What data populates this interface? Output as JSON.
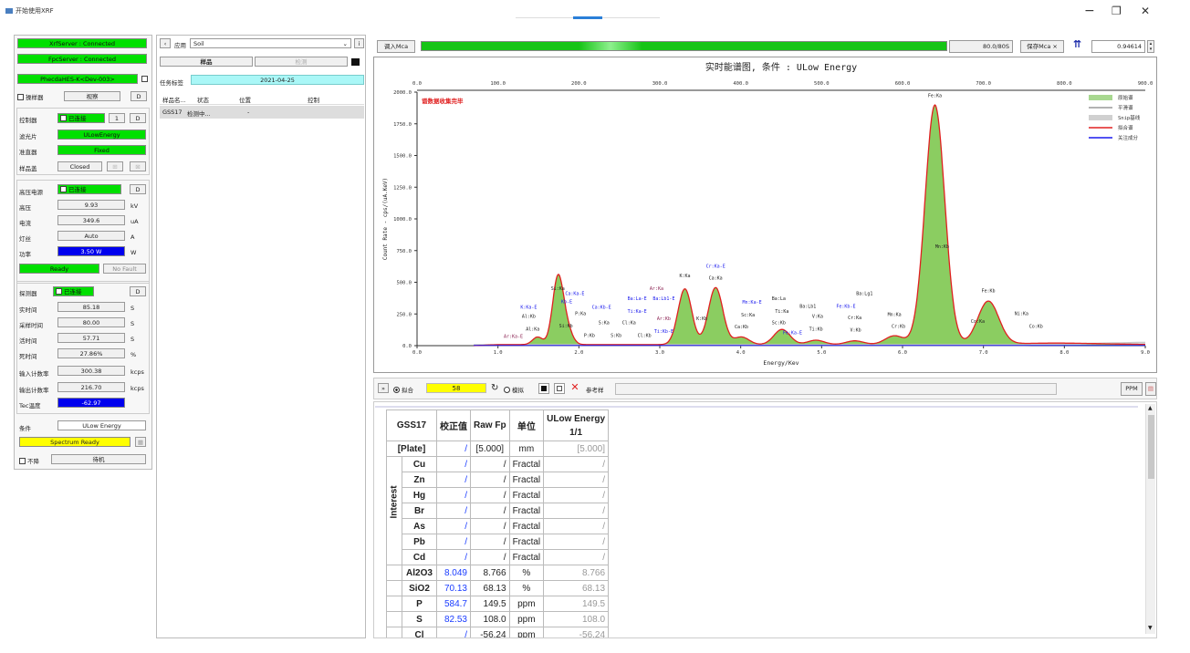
{
  "window": {
    "title": "开始使用XRF",
    "minimize": "−",
    "restore": "❐",
    "close": "✕"
  },
  "left": {
    "xrf_server": "XrfServer : Connected",
    "fpc_server": "FpcServer : Connected",
    "device": "PhecdaHES-K<Dev-003>",
    "sampler_label": "操样器",
    "sampler_btn": "视察",
    "d": "D",
    "controller": {
      "label": "控制器",
      "status": "已连接",
      "one": "1",
      "d": "D"
    },
    "filter": {
      "label": "滤光片",
      "value": "ULowEnergy"
    },
    "collimator": {
      "label": "准直器",
      "value": "Fixed"
    },
    "lid": {
      "label": "样品盖",
      "value": "Closed"
    },
    "hv": {
      "label": "高压电源",
      "status": "已连接",
      "d": "D",
      "rows": [
        {
          "label": "高压",
          "value": "9.93",
          "unit": "kV"
        },
        {
          "label": "电流",
          "value": "349.6",
          "unit": "uA"
        },
        {
          "label": "灯丝",
          "value": "Auto",
          "unit": "A"
        },
        {
          "label": "功率",
          "value": "3.50 W",
          "unit": "W"
        }
      ],
      "ready": "Ready",
      "fault": "No Fault"
    },
    "detector": {
      "label": "探测器",
      "status": "已连接",
      "d": "D",
      "rows": [
        {
          "label": "实时间",
          "value": "85.18",
          "unit": "S"
        },
        {
          "label": "采样时间",
          "value": "80.00",
          "unit": "S"
        },
        {
          "label": "活时间",
          "value": "57.71",
          "unit": "S"
        },
        {
          "label": "死时间",
          "value": "27.86%",
          "unit": "%"
        },
        {
          "label": "输入计数率",
          "value": "300.38",
          "unit": "kcps"
        },
        {
          "label": "输出计数率",
          "value": "216.70",
          "unit": "kcps"
        },
        {
          "label": "Tec温度",
          "value": "-62.97",
          "unit": ""
        }
      ]
    },
    "condition": {
      "label": "条件",
      "value": "ULow Energy"
    },
    "spectrum": "Spectrum Ready",
    "standby_chk": "不降",
    "standby": "待机"
  },
  "mid": {
    "app_label": "应用",
    "app_value": "Soil",
    "tab_sample": "样品",
    "tab_detect": "检测",
    "task_label": "任务标签",
    "task_value": "2021-04-25",
    "cols": [
      "样品名...",
      "状态",
      "位置",
      "控制"
    ],
    "row": [
      "GSS17",
      "检测中...",
      "-",
      ""
    ]
  },
  "toolbar": {
    "import": "调入Mca",
    "count": "80.0/80S",
    "save": "保存Mca ×",
    "value": "0.94614"
  },
  "chart_data": {
    "type": "line",
    "title": "实时能谱图, 条件 : ULow Energy",
    "annotation": "谱数据收集完毕",
    "xlabel": "Energy/Kev",
    "ylabel": "Count Rate - cps/(uA.KeV)",
    "xlim": [
      0,
      9
    ],
    "ylim": [
      0,
      2000
    ],
    "top_axis": [
      "0.0",
      "100.0",
      "200.0",
      "300.0",
      "400.0",
      "500.0",
      "600.0",
      "700.0",
      "800.0",
      "900.0"
    ],
    "x_ticks": [
      "0.0",
      "1.0",
      "2.0",
      "3.0",
      "4.0",
      "5.0",
      "6.0",
      "7.0",
      "8.0",
      "9.0"
    ],
    "y_ticks": [
      "0.0",
      "250.0",
      "500.0",
      "750.0",
      "1000.0",
      "1250.0",
      "1500.0",
      "1750.0",
      "2000.0"
    ],
    "legend": [
      "原始谱",
      "平滑谱",
      "Snip基线",
      "拟合谱",
      "关注成分"
    ],
    "colors": {
      "raw": "#7ec850",
      "smooth": "#999999",
      "snip": "#c8c8c8",
      "fit": "#e02020",
      "interest": "#1a1aee"
    },
    "peaks": [
      {
        "e": 1.74,
        "h": 520
      },
      {
        "e": 1.85,
        "h": 120
      },
      {
        "e": 1.49,
        "h": 60
      },
      {
        "e": 3.31,
        "h": 440
      },
      {
        "e": 3.69,
        "h": 450
      },
      {
        "e": 4.01,
        "h": 60
      },
      {
        "e": 4.51,
        "h": 120
      },
      {
        "e": 4.93,
        "h": 35
      },
      {
        "e": 5.41,
        "h": 30
      },
      {
        "e": 5.9,
        "h": 70
      },
      {
        "e": 6.4,
        "h": 1890
      },
      {
        "e": 7.06,
        "h": 340
      }
    ],
    "labels": [
      {
        "t": "Si:Ka",
        "e": 1.74,
        "c": 440,
        "col": "#222"
      },
      {
        "t": "Ca:Ka-E",
        "e": 1.95,
        "c": 400,
        "col": "#1a1aee"
      },
      {
        "t": "Kb-E",
        "e": 1.85,
        "c": 335,
        "col": "#1a1aee"
      },
      {
        "t": "K:Ka-E",
        "e": 1.38,
        "c": 290,
        "col": "#1a1aee"
      },
      {
        "t": "Al:Kb",
        "e": 1.38,
        "c": 220,
        "col": "#222"
      },
      {
        "t": "Al:Ka",
        "e": 1.43,
        "c": 120,
        "col": "#222"
      },
      {
        "t": "Ar:Ka-E",
        "e": 1.19,
        "c": 60,
        "col": "#8b2252"
      },
      {
        "t": "Si:Kb",
        "e": 1.84,
        "c": 145,
        "col": "#222"
      },
      {
        "t": "P:Ka",
        "e": 2.02,
        "c": 240,
        "col": "#222"
      },
      {
        "t": "P:Kb",
        "e": 2.13,
        "c": 70,
        "col": "#222"
      },
      {
        "t": "Ca:Kb-E",
        "e": 2.28,
        "c": 290,
        "col": "#1a1aee"
      },
      {
        "t": "S:Ka",
        "e": 2.31,
        "c": 170,
        "col": "#222"
      },
      {
        "t": "S:Kb",
        "e": 2.46,
        "c": 70,
        "col": "#222"
      },
      {
        "t": "Cl:Ka",
        "e": 2.62,
        "c": 170,
        "col": "#222"
      },
      {
        "t": "Cl:Kb",
        "e": 2.81,
        "c": 70,
        "col": "#222"
      },
      {
        "t": "Ba:La-E",
        "e": 2.72,
        "c": 360,
        "col": "#1a1aee"
      },
      {
        "t": "Ti:Ka-E",
        "e": 2.72,
        "c": 260,
        "col": "#1a1aee"
      },
      {
        "t": "Ar:Ka",
        "e": 2.96,
        "c": 440,
        "col": "#8b2252"
      },
      {
        "t": "Ba:Lb1-E",
        "e": 3.05,
        "c": 360,
        "col": "#1a1aee"
      },
      {
        "t": "Ar:Kb",
        "e": 3.05,
        "c": 200,
        "col": "#8b2252"
      },
      {
        "t": "Ti:Kb-E",
        "e": 3.05,
        "c": 100,
        "col": "#1a1aee"
      },
      {
        "t": "K:Ka",
        "e": 3.31,
        "c": 540,
        "col": "#222"
      },
      {
        "t": "K:Kb",
        "e": 3.52,
        "c": 200,
        "col": "#222"
      },
      {
        "t": "Cr:Ka-E",
        "e": 3.69,
        "c": 615,
        "col": "#1a1aee"
      },
      {
        "t": "Ca:Ka",
        "e": 3.69,
        "c": 520,
        "col": "#222"
      },
      {
        "t": "Ca:Kb",
        "e": 4.01,
        "c": 135,
        "col": "#222"
      },
      {
        "t": "Mn:Ka-E",
        "e": 4.14,
        "c": 330,
        "col": "#1a1aee"
      },
      {
        "t": "Sc:Ka",
        "e": 4.09,
        "c": 230,
        "col": "#222"
      },
      {
        "t": "Ba:La",
        "e": 4.47,
        "c": 360,
        "col": "#222"
      },
      {
        "t": "Ti:Ka",
        "e": 4.51,
        "c": 260,
        "col": "#222"
      },
      {
        "t": "Sc:Kb",
        "e": 4.47,
        "c": 170,
        "col": "#222"
      },
      {
        "t": "Fe:Ka-E",
        "e": 4.64,
        "c": 90,
        "col": "#1a1aee"
      },
      {
        "t": "Ba:Lb1",
        "e": 4.83,
        "c": 300,
        "col": "#222"
      },
      {
        "t": "V:Ka",
        "e": 4.95,
        "c": 220,
        "col": "#222"
      },
      {
        "t": "Ti:Kb",
        "e": 4.93,
        "c": 120,
        "col": "#222"
      },
      {
        "t": "Fe:Kb-E",
        "e": 5.3,
        "c": 300,
        "col": "#1a1aee"
      },
      {
        "t": "Ba:Lg1",
        "e": 5.53,
        "c": 400,
        "col": "#222"
      },
      {
        "t": "Cr:Ka",
        "e": 5.41,
        "c": 210,
        "col": "#222"
      },
      {
        "t": "V:Kb",
        "e": 5.42,
        "c": 110,
        "col": "#222"
      },
      {
        "t": "Mn:Ka",
        "e": 5.9,
        "c": 235,
        "col": "#222"
      },
      {
        "t": "Cr:Kb",
        "e": 5.95,
        "c": 140,
        "col": "#222"
      },
      {
        "t": "Fe:Ka",
        "e": 6.4,
        "c": 1960,
        "col": "#222"
      },
      {
        "t": "Mn:Kb",
        "e": 6.49,
        "c": 770,
        "col": "#222"
      },
      {
        "t": "Fe:Kb",
        "e": 7.06,
        "c": 420,
        "col": "#222"
      },
      {
        "t": "Co:Ka",
        "e": 6.93,
        "c": 180,
        "col": "#222"
      },
      {
        "t": "Ni:Ka",
        "e": 7.47,
        "c": 240,
        "col": "#222"
      },
      {
        "t": "Co:Kb",
        "e": 7.65,
        "c": 140,
        "col": "#222"
      }
    ]
  },
  "lower": {
    "mode_fit": "拟合",
    "count": "58",
    "mode_sim": "模拟",
    "ref_label": "参考样",
    "ppm": "PPM"
  },
  "table": {
    "sample": "GSS17",
    "h_corr": "校正值",
    "h_raw": "Raw Fp",
    "h_unit": "单位",
    "h_cond": "ULow Energy",
    "h_cond2": "1/1",
    "plate": {
      "name": "[Plate]",
      "corr": "/",
      "raw": "[5.000]",
      "unit": "mm",
      "v": "[5.000]"
    },
    "group": "Interest",
    "interest": [
      {
        "el": "Cu",
        "corr": "/",
        "raw": "/",
        "unit": "Fractal",
        "v": "/"
      },
      {
        "el": "Zn",
        "corr": "/",
        "raw": "/",
        "unit": "Fractal",
        "v": "/"
      },
      {
        "el": "Hg",
        "corr": "/",
        "raw": "/",
        "unit": "Fractal",
        "v": "/"
      },
      {
        "el": "Br",
        "corr": "/",
        "raw": "/",
        "unit": "Fractal",
        "v": "/"
      },
      {
        "el": "As",
        "corr": "/",
        "raw": "/",
        "unit": "Fractal",
        "v": "/"
      },
      {
        "el": "Pb",
        "corr": "/",
        "raw": "/",
        "unit": "Fractal",
        "v": "/"
      },
      {
        "el": "Cd",
        "corr": "/",
        "raw": "/",
        "unit": "Fractal",
        "v": "/"
      }
    ],
    "other": [
      {
        "el": "Al2O3",
        "corr": "8.049",
        "raw": "8.766",
        "unit": "%",
        "v": "8.766"
      },
      {
        "el": "SiO2",
        "corr": "70.13",
        "raw": "68.13",
        "unit": "%",
        "v": "68.13"
      },
      {
        "el": "P",
        "corr": "584.7",
        "raw": "149.5",
        "unit": "ppm",
        "v": "149.5"
      },
      {
        "el": "S",
        "corr": "82.53",
        "raw": "108.0",
        "unit": "ppm",
        "v": "108.0"
      },
      {
        "el": "Cl",
        "corr": "/",
        "raw": "-56.24",
        "unit": "ppm",
        "v": "-56.24"
      }
    ]
  }
}
